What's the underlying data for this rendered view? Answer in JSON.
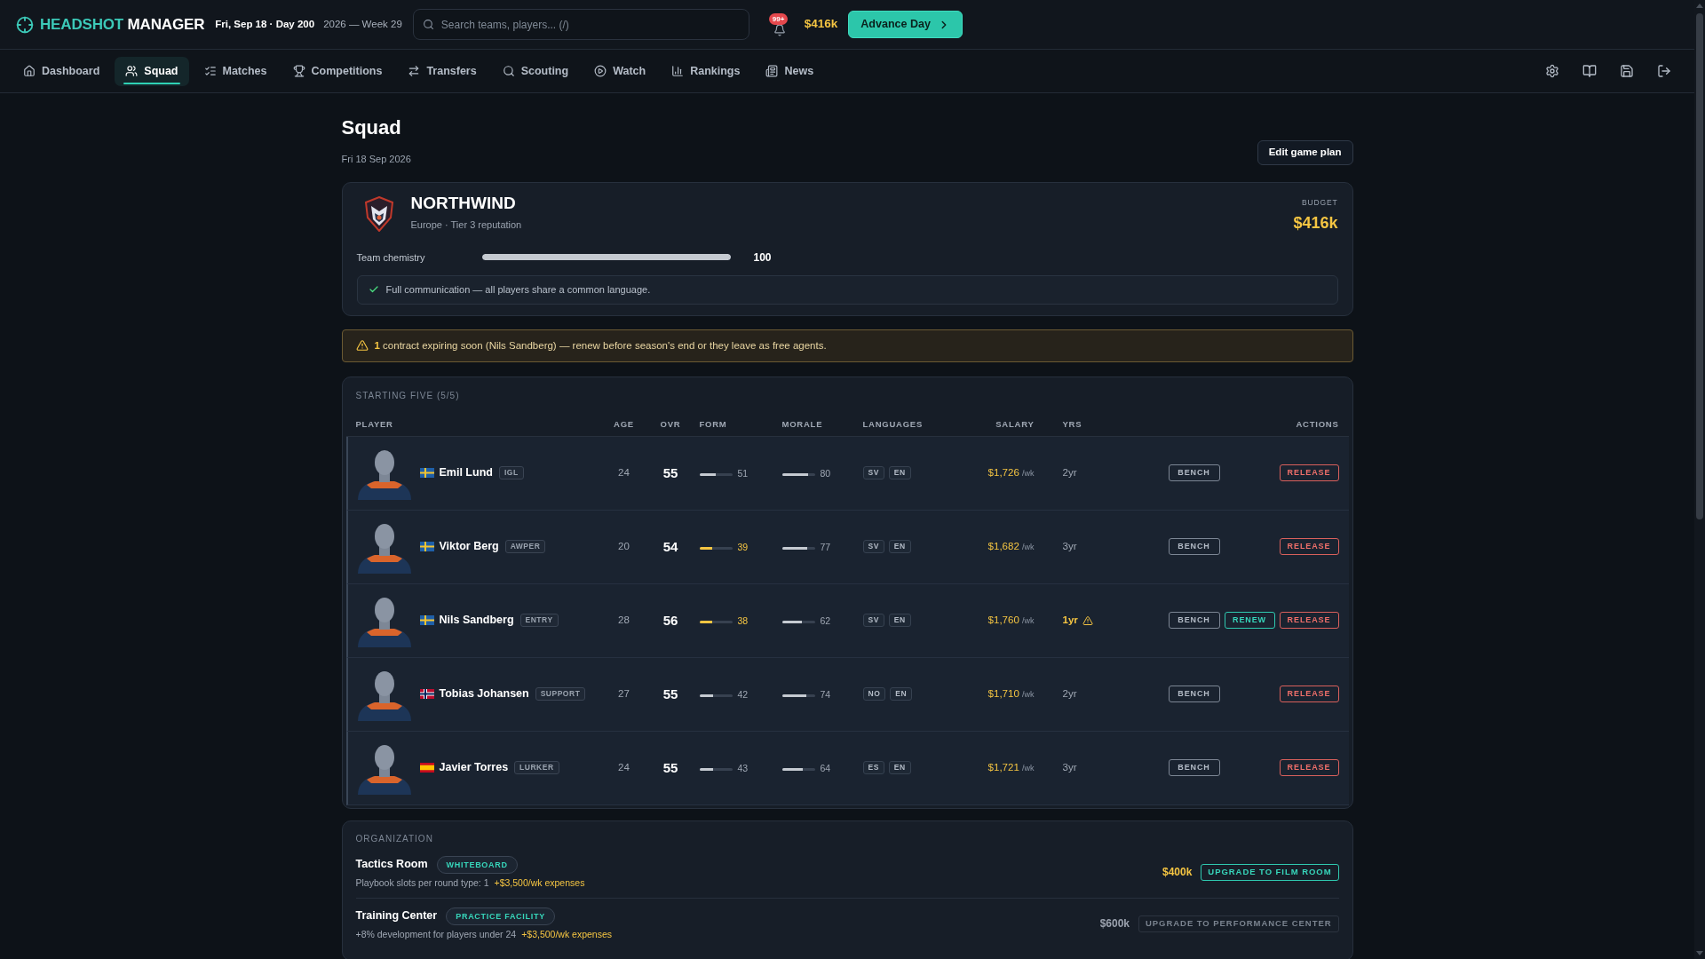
{
  "header": {
    "brand_first": "HEADSHOT",
    "brand_second": "MANAGER",
    "date": "Fri, Sep 18 · Day 200",
    "week": "2026 — Week 29",
    "search": {
      "placeholder": "Search teams, players... (/)"
    },
    "notifications": "99+",
    "balance": "$416k",
    "advance_button": "Advance Day"
  },
  "nav": {
    "items": [
      {
        "label": "Dashboard",
        "selected": false
      },
      {
        "label": "Squad",
        "selected": true
      },
      {
        "label": "Matches",
        "selected": false
      },
      {
        "label": "Competitions",
        "selected": false
      },
      {
        "label": "Transfers",
        "selected": false
      },
      {
        "label": "Scouting",
        "selected": false
      },
      {
        "label": "Watch",
        "selected": false
      },
      {
        "label": "Rankings",
        "selected": false
      },
      {
        "label": "News",
        "selected": false
      }
    ]
  },
  "page": {
    "title": "Squad",
    "date": "Fri 18 Sep 2026",
    "edit_button": "Edit game plan"
  },
  "team": {
    "name": "NORTHWIND",
    "subtitle": "Europe · Tier 3 reputation",
    "budget_label": "BUDGET",
    "budget": "$416k",
    "chemistry": {
      "label": "Team chemistry",
      "level": 1,
      "value": "100"
    },
    "notice": "Full communication — all players share a common language."
  },
  "alert": "**1** contract expiring soon (Nils Sandberg) — renew before season's end or they leave as free agents.",
  "starting_five": {
    "title": "STARTING FIVE (5/5)",
    "columns": [
      "PLAYER",
      "AGE",
      "OVR",
      "FORM",
      "MORALE",
      "LANGUAGES",
      "SALARY",
      "YRS",
      "ACTIONS"
    ],
    "rows": [
      {
        "kind": "se",
        "name": "Emil Lund",
        "role": "IGL",
        "age": "24",
        "ovr": "55",
        "form": {
          "value": "51",
          "level": 0.51,
          "low": false
        },
        "morale": {
          "value": "80",
          "level": 0.8
        },
        "languages": [
          "SV",
          "EN"
        ],
        "salary": "$1,726",
        "salary_unit": "/wk",
        "years": "2yr",
        "expiring": false,
        "actions": [
          {
            "label": "BENCH",
            "kind": "bench"
          },
          {
            "label": "RELEASE",
            "kind": "release"
          }
        ]
      },
      {
        "kind": "se",
        "name": "Viktor Berg",
        "role": "AWPER",
        "age": "20",
        "ovr": "54",
        "form": {
          "value": "39",
          "level": 0.39,
          "low": true
        },
        "morale": {
          "value": "77",
          "level": 0.77
        },
        "languages": [
          "SV",
          "EN"
        ],
        "salary": "$1,682",
        "salary_unit": "/wk",
        "years": "3yr",
        "expiring": false,
        "actions": [
          {
            "label": "BENCH",
            "kind": "bench"
          },
          {
            "label": "RELEASE",
            "kind": "release"
          }
        ]
      },
      {
        "kind": "se",
        "name": "Nils Sandberg",
        "role": "ENTRY",
        "age": "28",
        "ovr": "56",
        "form": {
          "value": "38",
          "level": 0.38,
          "low": true
        },
        "morale": {
          "value": "62",
          "level": 0.62
        },
        "languages": [
          "SV",
          "EN"
        ],
        "salary": "$1,760",
        "salary_unit": "/wk",
        "years": "1yr",
        "expiring": true,
        "actions": [
          {
            "label": "BENCH",
            "kind": "bench"
          },
          {
            "label": "RENEW",
            "kind": "renew"
          },
          {
            "label": "RELEASE",
            "kind": "release"
          }
        ]
      },
      {
        "kind": "no",
        "name": "Tobias Johansen",
        "role": "SUPPORT",
        "age": "27",
        "ovr": "55",
        "form": {
          "value": "42",
          "level": 0.42,
          "low": false
        },
        "morale": {
          "value": "74",
          "level": 0.74
        },
        "languages": [
          "NO",
          "EN"
        ],
        "salary": "$1,710",
        "salary_unit": "/wk",
        "years": "2yr",
        "expiring": false,
        "actions": [
          {
            "label": "BENCH",
            "kind": "bench"
          },
          {
            "label": "RELEASE",
            "kind": "release"
          }
        ]
      },
      {
        "kind": "es",
        "name": "Javier Torres",
        "role": "LURKER",
        "age": "24",
        "ovr": "55",
        "form": {
          "value": "43",
          "level": 0.43,
          "low": false
        },
        "morale": {
          "value": "64",
          "level": 0.64
        },
        "languages": [
          "ES",
          "EN"
        ],
        "salary": "$1,721",
        "salary_unit": "/wk",
        "years": "3yr",
        "expiring": false,
        "actions": [
          {
            "label": "BENCH",
            "kind": "bench"
          },
          {
            "label": "RELEASE",
            "kind": "release"
          }
        ]
      }
    ]
  },
  "organization": {
    "title": "ORGANIZATION",
    "facilities": [
      {
        "name": "Tactics Room",
        "tier": "WHITEBOARD",
        "effect": "Playbook slots per round type: 1",
        "expense": "+$3,500/wk expenses",
        "cost": "$400k",
        "upgrade": "UPGRADE TO FILM ROOM",
        "disabled": false
      },
      {
        "name": "Training Center",
        "tier": "PRACTICE FACILITY",
        "effect": "+8% development for players under 24",
        "expense": "+$3,500/wk expenses",
        "cost": "$600k",
        "upgrade": "UPGRADE TO PERFORMANCE CENTER",
        "disabled": true
      }
    ]
  }
}
